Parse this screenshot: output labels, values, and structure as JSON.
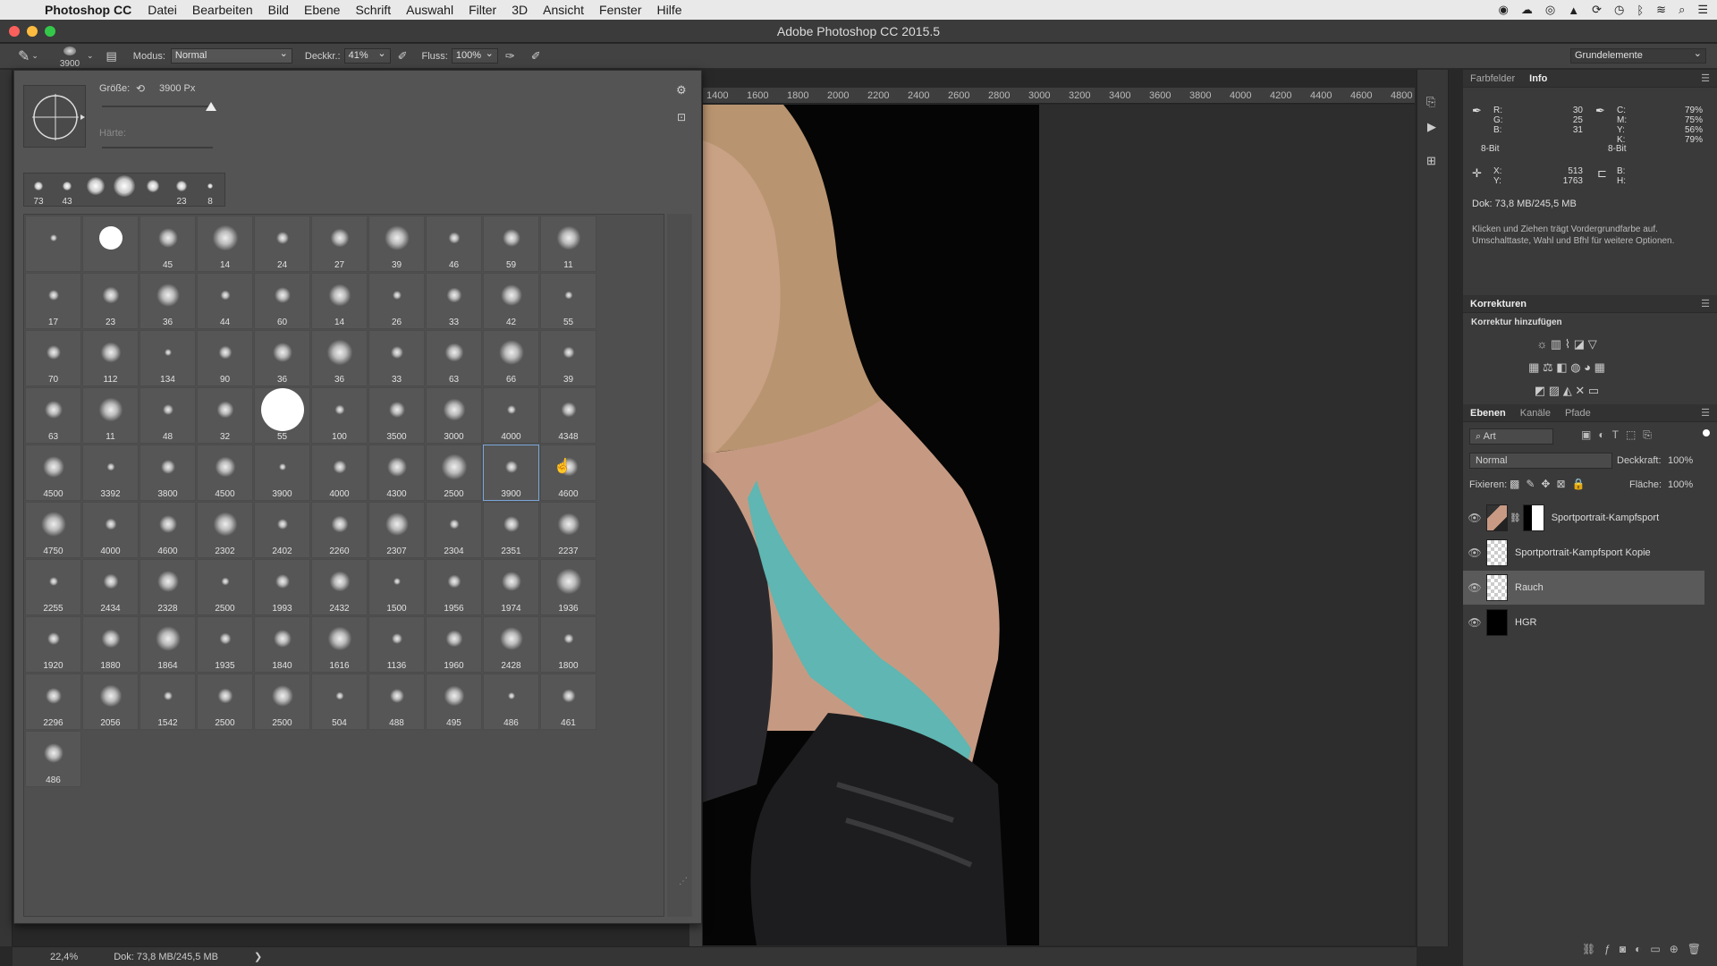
{
  "menubar": {
    "app_name": "Photoshop CC",
    "items": [
      "Datei",
      "Bearbeiten",
      "Bild",
      "Ebene",
      "Schrift",
      "Auswahl",
      "Filter",
      "3D",
      "Ansicht",
      "Fenster",
      "Hilfe"
    ]
  },
  "window": {
    "title": "Adobe Photoshop CC 2015.5"
  },
  "options": {
    "brush_size_label": "3900",
    "mode_label": "Modus:",
    "mode_value": "Normal",
    "opacity_label": "Deckkr.:",
    "opacity_value": "41%",
    "flow_label": "Fluss:",
    "flow_value": "100%",
    "workspace": "Grundelemente"
  },
  "brush_picker": {
    "size_label": "Größe:",
    "size_value": "3900 Px",
    "hardness_label": "Härte:",
    "size_slider_fraction": 0.98,
    "recent": [
      "73",
      "43",
      "",
      "",
      "",
      "23",
      "8"
    ],
    "presets": [
      "",
      "",
      "45",
      "14",
      "24",
      "27",
      "39",
      "46",
      "59",
      "11",
      "17",
      "23",
      "36",
      "44",
      "60",
      "14",
      "26",
      "33",
      "42",
      "55",
      "70",
      "112",
      "134",
      "90",
      "36",
      "36",
      "33",
      "63",
      "66",
      "39",
      "63",
      "11",
      "48",
      "32",
      "55",
      "100",
      "3500",
      "3000",
      "4000",
      "4348",
      "4500",
      "3392",
      "3800",
      "4500",
      "3900",
      "4000",
      "4300",
      "2500",
      "3900",
      "4600",
      "4750",
      "4000",
      "4600",
      "2302",
      "2402",
      "2260",
      "2307",
      "2304",
      "2351",
      "2237",
      "2255",
      "2434",
      "2328",
      "2500",
      "1993",
      "2432",
      "1500",
      "1956",
      "1974",
      "1936",
      "1920",
      "1880",
      "1864",
      "1935",
      "1840",
      "1616",
      "1136",
      "1960",
      "2428",
      "1800",
      "2296",
      "2056",
      "1542",
      "2500",
      "2500",
      "504",
      "488",
      "495",
      "486",
      "461",
      "486"
    ],
    "selected_index": 48
  },
  "ruler": {
    "ticks": [
      "1400",
      "1600",
      "1800",
      "2000",
      "2200",
      "2400",
      "2600",
      "2800",
      "3000",
      "3200",
      "3400",
      "3600",
      "3800",
      "4000",
      "4200",
      "4400",
      "4600",
      "4800"
    ]
  },
  "status": {
    "zoom": "22,4%",
    "doc": "Dok: 73,8 MB/245,5 MB",
    "arrow": "❯"
  },
  "info_panel": {
    "tabs": [
      "Farbfelder",
      "Info"
    ],
    "r_label": "R:",
    "r": "30",
    "g_label": "G:",
    "g": "25",
    "b_label": "B:",
    "b": "31",
    "c_label": "C:",
    "c": "79%",
    "m_label": "M:",
    "m": "75%",
    "y_label": "Y:",
    "y": "56%",
    "k_label": "K:",
    "k": "79%",
    "bit_left": "8-Bit",
    "bit_right": "8-Bit",
    "x_label": "X:",
    "x": "513",
    "yy_label": "Y:",
    "yy": "1763",
    "b2_label": "B:",
    "h_label": "H:",
    "doc": "Dok: 73,8 MB/245,5 MB",
    "hint": "Klicken und Ziehen trägt Vordergrundfarbe auf. Umschalttaste, Wahl und Bfhl für weitere Optionen."
  },
  "adjustments": {
    "title": "Korrekturen",
    "subtitle": "Korrektur hinzufügen"
  },
  "layers_panel": {
    "tabs": [
      "Ebenen",
      "Kanäle",
      "Pfade"
    ],
    "filter_kind": "Art",
    "blend_mode": "Normal",
    "opacity_label": "Deckkraft:",
    "opacity_value": "100%",
    "lock_label": "Fixieren:",
    "fill_label": "Fläche:",
    "fill_value": "100%",
    "layers": [
      {
        "name": "Sportportrait-Kampfsport"
      },
      {
        "name": "Sportportrait-Kampfsport Kopie"
      },
      {
        "name": "Rauch"
      },
      {
        "name": "HGR"
      }
    ],
    "selected_layer": 2
  },
  "colors": {
    "accent": "#7aa6d8",
    "panel": "#545454",
    "bg": "#282828"
  }
}
